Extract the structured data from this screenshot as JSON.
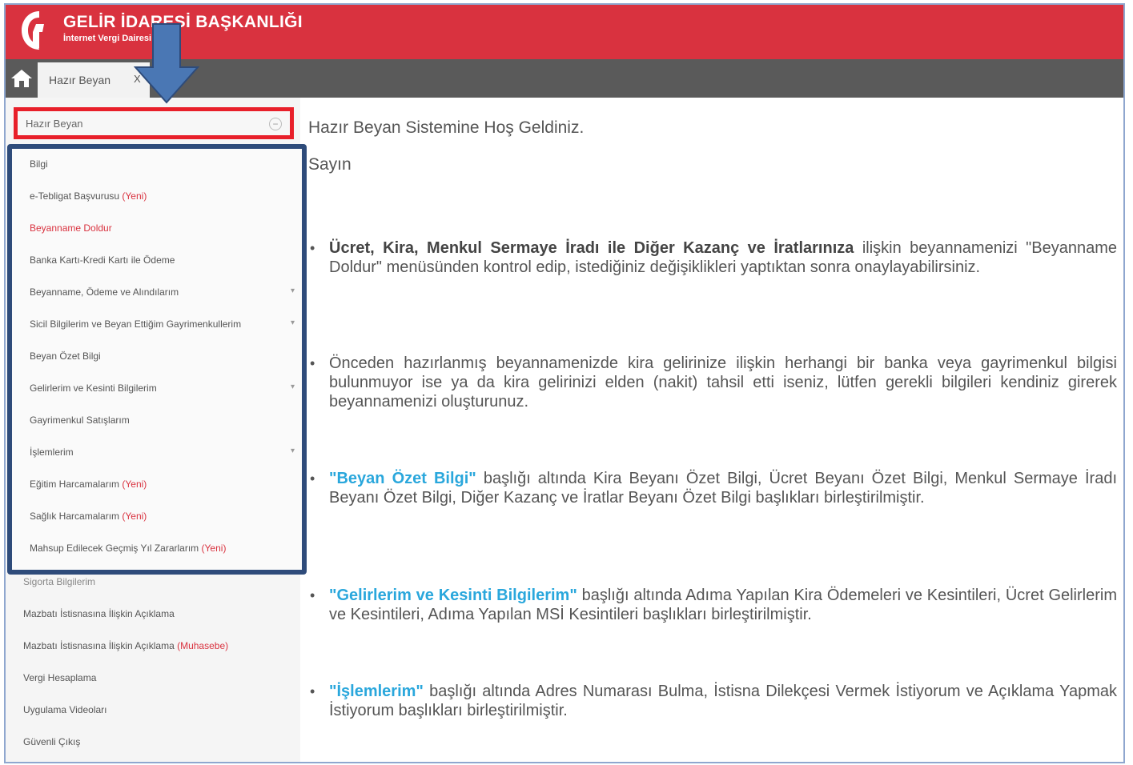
{
  "header": {
    "title": "GELİR İDARESİ BAŞKANLIĞI",
    "subtitle": "İnternet Vergi Dairesi",
    "brand_color": "#d9323f"
  },
  "tabs": [
    {
      "label": "Hazır Beyan",
      "close": "X"
    }
  ],
  "home_icon": "home-icon",
  "sidebar": {
    "header": "Hazır Beyan",
    "menu": [
      {
        "label": "Bilgi"
      },
      {
        "label": "e-Tebligat Başvurusu",
        "badge": "(Yeni)"
      },
      {
        "label": "Beyanname Doldur"
      },
      {
        "label": "Banka Kartı-Kredi Kartı ile Ödeme"
      },
      {
        "label": "Beyanname, Ödeme ve Alındılarım"
      },
      {
        "label": "Sicil Bilgilerim ve Beyan Ettiğim Gayrimenkullerim"
      },
      {
        "label": "Beyan Özet Bilgi"
      },
      {
        "label": "Gelirlerim ve Kesinti Bilgilerim"
      },
      {
        "label": "Gayrimenkul Satışlarım"
      },
      {
        "label": "İşlemlerim"
      },
      {
        "label": "Eğitim Harcamalarım",
        "badge": "(Yeni)"
      },
      {
        "label": "Sağlık Harcamalarım",
        "badge": "(Yeni)"
      },
      {
        "label": "Mahsup Edilecek Geçmiş Yıl Zararlarım",
        "badge": "(Yeni)"
      }
    ],
    "below": [
      {
        "label": "Sigorta Bilgilerim"
      },
      {
        "label": "Mazbatı İstisnasına İlişkin Açıklama"
      },
      {
        "label": "Mazbatı İstisnasına İlişkin Açıklama",
        "badge": "(Muhasebe)"
      },
      {
        "label": "Vergi Hesaplama"
      },
      {
        "label": "Uygulama Videoları"
      },
      {
        "label": "Güvenli Çıkış"
      }
    ]
  },
  "content": {
    "welcome": "Hazır Beyan Sistemine Hoş Geldiniz.",
    "greeting": "Sayın",
    "b1_bold": "Ücret, Kira, Menkul Sermaye İradı ile Diğer Kazanç ve İratlarınıza",
    "b1_rest": " ilişkin beyannamenizi \"Beyanname Doldur\" menüsünden kontrol edip, istediğiniz değişiklikleri yaptıktan sonra onaylayabilirsiniz.",
    "b2": "Önceden hazırlanmış beyannamenizde kira gelirinize ilişkin herhangi bir banka veya gayrimenkul bilgisi bulunmuyor ise ya da kira gelirinizi elden (nakit) tahsil etti iseniz, lütfen gerekli bilgileri kendiniz girerek beyannamenizi oluşturunuz.",
    "b3_hl": "\"Beyan Özet Bilgi\"",
    "b3_rest": " başlığı altında Kira Beyanı Özet Bilgi, Ücret Beyanı Özet Bilgi, Menkul Sermaye İradı Beyanı Özet Bilgi, Diğer Kazanç ve İratlar Beyanı Özet Bilgi başlıkları birleştirilmiştir.",
    "b4_hl": "\"Gelirlerim ve Kesinti Bilgilerim\"",
    "b4_rest": " başlığı altında Adıma Yapılan Kira Ödemeleri ve Kesintileri, Ücret Gelirlerim ve Kesintileri, Adıma Yapılan MSİ Kesintileri başlıkları birleştirilmiştir.",
    "b5_hl": "\"İşlemlerim\"",
    "b5_rest": " başlığı altında Adres Numarası Bulma, İstisna Dilekçesi Vermek İstiyorum ve Açıklama Yapmak İstiyorum başlıkları birleştirilmiştir."
  },
  "colors": {
    "accent_link": "#2aa7dc",
    "highlight_red": "#e8202a",
    "highlight_blue": "#2e4b7a"
  }
}
